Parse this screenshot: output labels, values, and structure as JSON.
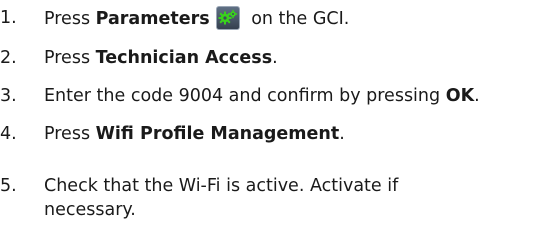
{
  "steps": [
    {
      "number": "1.",
      "before": "Press ",
      "bold": "Parameters",
      "after": " on the GCI.",
      "icon": "parameters-gears-icon"
    },
    {
      "number": "2.",
      "before": "Press ",
      "bold": "Technician Access",
      "after": "."
    },
    {
      "number": "3.",
      "before": "Enter the code 9004 and confirm by pressing ",
      "bold": "OK",
      "after": "."
    },
    {
      "number": "4.",
      "before": "Press ",
      "bold": "Wifi Profile Management",
      "after": "."
    },
    {
      "number": "5.",
      "text": "Check that the Wi-Fi is active. Activate if necessary."
    }
  ],
  "colors": {
    "text": "#1a1a1a",
    "icon_background": "#3f4b5c",
    "icon_gear": "#39d21c"
  }
}
